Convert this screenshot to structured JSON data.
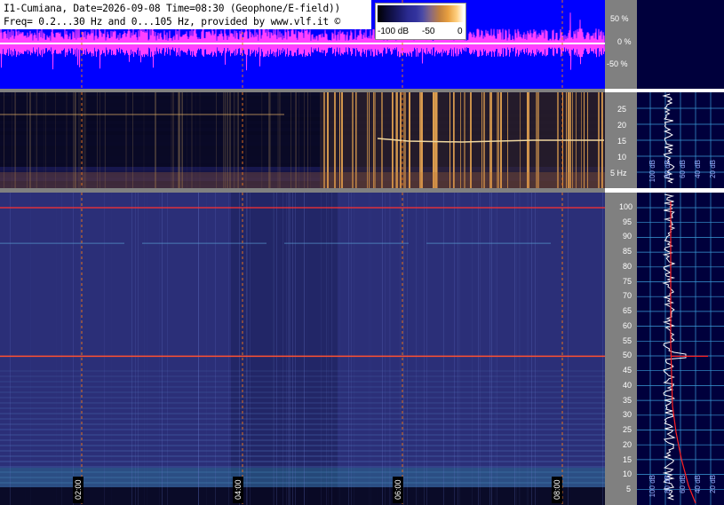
{
  "header": {
    "line1": "I1-Cumiana, Date=2026-09-08 Time=08:30 (Geophone/E-field))",
    "line2": "Freq= 0.2...30 Hz and 0...105 Hz, provided by www.vlf.it ©"
  },
  "colorbar": {
    "labels": [
      "-100 dB",
      "-50",
      "0"
    ]
  },
  "waveform": {
    "scale_labels": [
      "50 %",
      "0 %",
      "-50 %"
    ],
    "colors": {
      "background": "#0000ff",
      "signal": "#ff40ff"
    }
  },
  "spectrogram_low": {
    "freq_labels": [
      "25",
      "20",
      "15",
      "10",
      "5 Hz"
    ],
    "right_labels": [
      "100 dB",
      "80 dB",
      "60 dB",
      "40 dB",
      "20 dB"
    ]
  },
  "spectrogram_high": {
    "freq_labels": [
      "100",
      "95",
      "90",
      "85",
      "80",
      "75",
      "70",
      "65",
      "60",
      "55",
      "50",
      "45",
      "40",
      "35",
      "30",
      "25",
      "20",
      "15",
      "10",
      "5"
    ],
    "right_labels": [
      "100 dB",
      "80 dB",
      "60 dB",
      "40 dB",
      "20 dB"
    ]
  },
  "time_axis": {
    "labels": [
      "02:00",
      "04:00",
      "06:00",
      "08:00"
    ]
  },
  "colors": {
    "panel_bg": "#00003c",
    "grid_lines": "#3a9cd8",
    "time_markers": "#e07020",
    "spectrum_trace": "#ffffff",
    "average_trace": "#ff2020"
  }
}
